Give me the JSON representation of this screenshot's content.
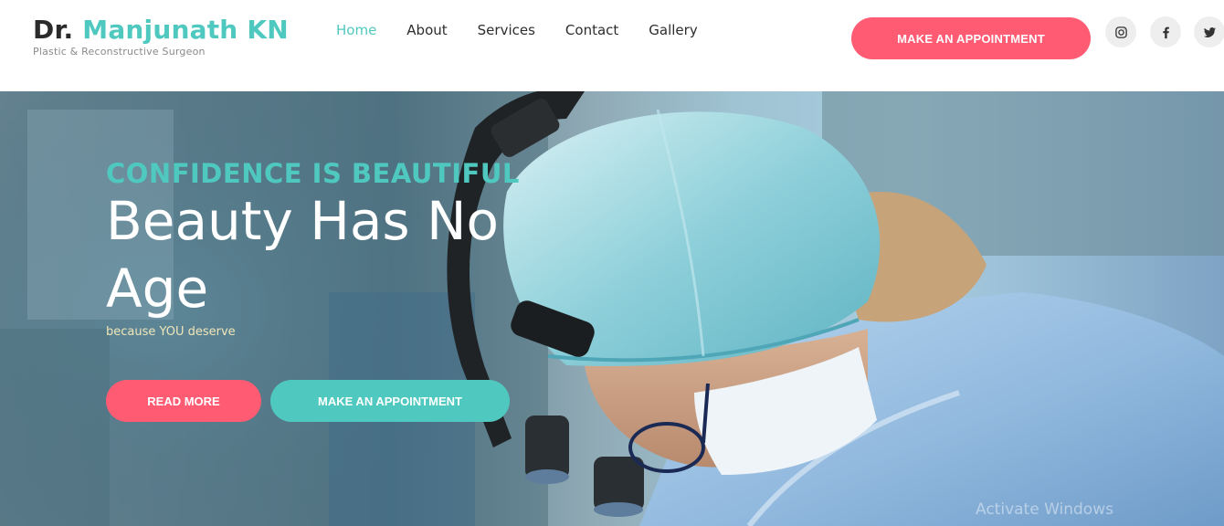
{
  "header": {
    "brand_prefix": "Dr.",
    "brand_name": "Manjunath KN",
    "tagline": "Plastic & Reconstructive Surgeon",
    "nav": [
      {
        "label": "Home",
        "active": true
      },
      {
        "label": "About"
      },
      {
        "label": "Services"
      },
      {
        "label": "Contact"
      },
      {
        "label": "Gallery"
      }
    ],
    "cta_label": "MAKE AN APPOINTMENT",
    "social_icons": [
      "instagram-icon",
      "facebook-icon",
      "twitter-icon"
    ]
  },
  "hero": {
    "kicker": "CONFIDENCE IS BEAUTIFUL",
    "title": "Beauty Has No Age",
    "subtitle": "because YOU deserve",
    "read_more_label": "READ MORE",
    "appointment_label": "MAKE AN APPOINTMENT"
  },
  "watermark": "Activate Windows",
  "colors": {
    "accent": "#4fc9bf",
    "primary_button": "#ff5c74",
    "text_dark": "#2b2b2b"
  }
}
